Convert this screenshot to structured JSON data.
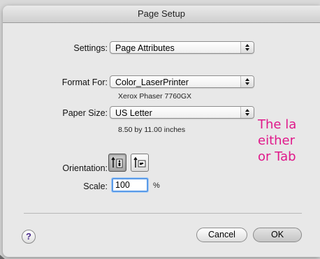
{
  "dialog": {
    "title": "Page Setup",
    "settings": {
      "label": "Settings:",
      "value": "Page Attributes"
    },
    "format_for": {
      "label": "Format For:",
      "value": "Color_LaserPrinter",
      "subtitle": "Xerox Phaser 7760GX"
    },
    "paper_size": {
      "label": "Paper Size:",
      "value": "US Letter",
      "subtitle": "8.50 by 11.00 inches"
    },
    "orientation": {
      "label": "Orientation:",
      "selected": "portrait"
    },
    "scale": {
      "label": "Scale:",
      "value": "100",
      "unit": "%"
    },
    "help_label": "?",
    "cancel_label": "Cancel",
    "ok_label": "OK"
  },
  "annotation": {
    "lines": [
      "The la",
      "either",
      "or Tab"
    ],
    "color": "#e0188a"
  }
}
